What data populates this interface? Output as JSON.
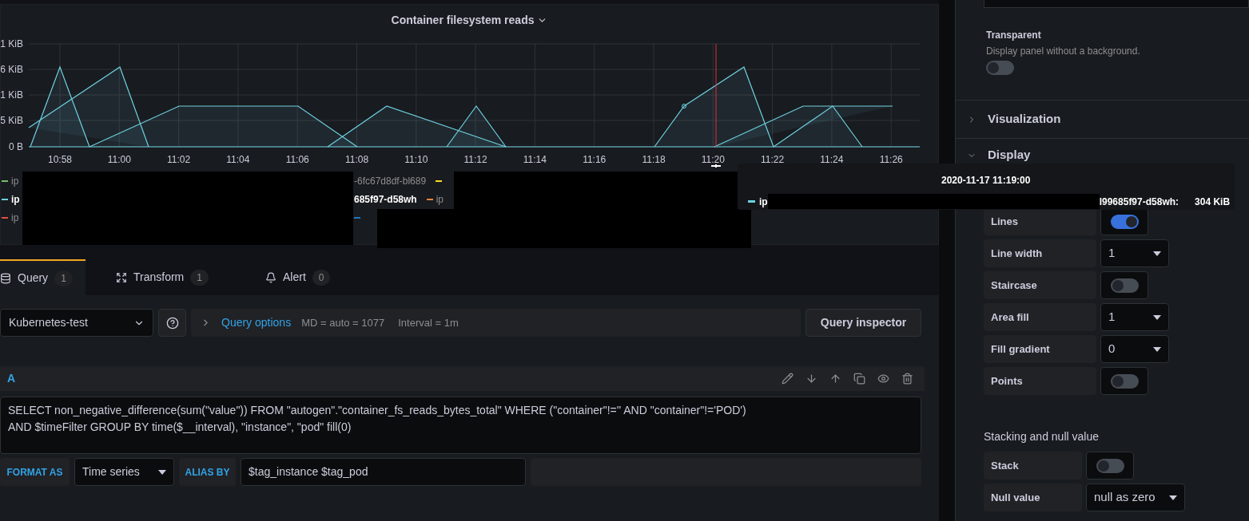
{
  "panel": {
    "title": "Container filesystem reads",
    "y_ticks": [
      "1 KiB",
      "6 KiB",
      "1 KiB",
      "5 KiB",
      "0 B"
    ],
    "x_ticks": [
      "10:58",
      "11:00",
      "11:02",
      "11:04",
      "11:06",
      "11:08",
      "11:10",
      "11:12",
      "11:14",
      "11:16",
      "11:18",
      "11:20",
      "11:22",
      "11:24",
      "11:26"
    ],
    "legend": [
      {
        "first": {
          "color": "#73bf69",
          "text": "ip",
          "highlighted": false
        },
        "rest": [
          {
            "text": "-6fc67d8df-bl689",
            "highlighted": false
          },
          {
            "color": "#fade2a"
          }
        ]
      },
      {
        "first": {
          "color": "#6ed0e0",
          "text": "ip",
          "highlighted": true
        },
        "rest": [
          {
            "text": "685f97-d58wh",
            "highlighted": true
          },
          {
            "color": "#ef843c",
            "text": "ip",
            "highlighted": false
          }
        ]
      },
      {
        "first": {
          "color": "#e24d42",
          "text": "ip",
          "highlighted": false
        },
        "rest": [
          {
            "color": "#1f78c1"
          }
        ]
      }
    ],
    "tooltip": {
      "time": "2020-11-17 11:19:00",
      "series_start": "ip",
      "series_end": "l99685f97-d58wh:",
      "value": "304 KiB",
      "color": "#6ed0e0"
    }
  },
  "tabs": [
    {
      "label": "Query",
      "count": "1",
      "selected": true,
      "kind": "query"
    },
    {
      "label": "Transform",
      "count": "1",
      "selected": false,
      "kind": "transform"
    },
    {
      "label": "Alert",
      "count": "0",
      "selected": false,
      "kind": "alert"
    }
  ],
  "query_toolbar": {
    "datasource": "Kubernetes-test",
    "options_label": "Query options",
    "md": "MD = auto = 1077",
    "interval": "Interval = 1m",
    "inspector": "Query inspector"
  },
  "query": {
    "ref": "A",
    "text": "SELECT non_negative_difference(sum(\"value\")) FROM \"autogen\".\"container_fs_reads_bytes_total\" WHERE (\"container\"!='' AND \"container\"!='POD') AND $timeFilter GROUP BY time($__interval), \"instance\", \"pod\" fill(0)",
    "format_label": "FORMAT AS",
    "format": "Time series",
    "alias_label": "ALIAS BY",
    "alias": "$tag_instance $tag_pod"
  },
  "options": {
    "transparent": {
      "label": "Transparent",
      "description": "Display panel without a background.",
      "on": false
    },
    "sections": [
      {
        "title": "Visualization",
        "expanded": false
      },
      {
        "title": "Display",
        "expanded": true
      }
    ],
    "display": [
      {
        "kind": "switch",
        "label": "Lines",
        "on": true
      },
      {
        "kind": "select",
        "label": "Line width",
        "value": "1"
      },
      {
        "kind": "switch",
        "label": "Staircase",
        "on": false
      },
      {
        "kind": "select",
        "label": "Area fill",
        "value": "1"
      },
      {
        "kind": "select",
        "label": "Fill gradient",
        "value": "0"
      },
      {
        "kind": "switch",
        "label": "Points",
        "on": false
      }
    ],
    "stacking_title": "Stacking and null value",
    "stacking": [
      {
        "kind": "switch",
        "label": "Stack",
        "on": false
      },
      {
        "kind": "select",
        "label": "Null value",
        "value": "null as zero"
      }
    ]
  }
}
